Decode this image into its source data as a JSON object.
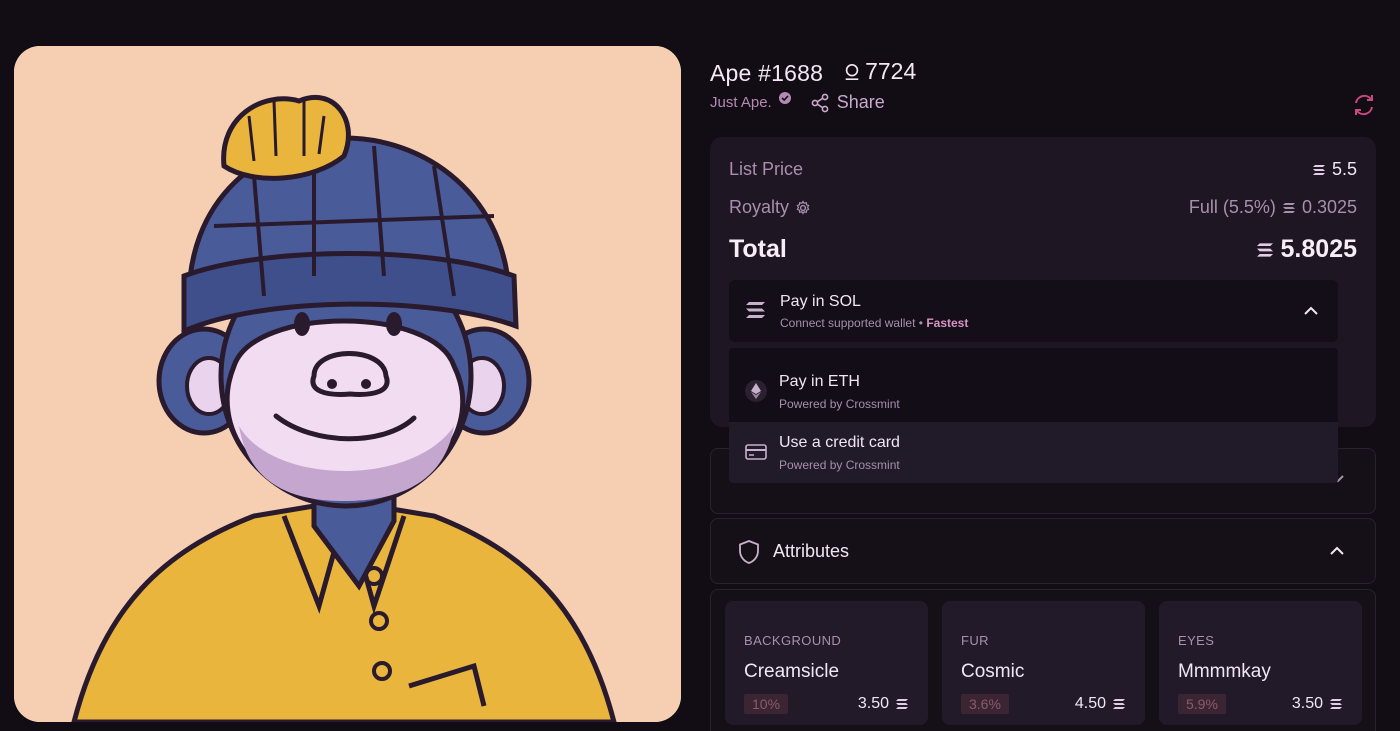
{
  "nft": {
    "name": "Ape #1688",
    "rank": "7724",
    "collection": "Just Ape.",
    "share_label": "Share"
  },
  "pricing": {
    "list_price_label": "List Price",
    "list_price_value": "5.5",
    "royalty_label": "Royalty",
    "royalty_mode": "Full (5.5%)",
    "royalty_value": "0.3025",
    "total_label": "Total",
    "total_value": "5.8025"
  },
  "payment": {
    "selected": {
      "title": "Pay in SOL",
      "subtitle": "Connect supported wallet",
      "separator": "•",
      "badge": "Fastest"
    },
    "options": [
      {
        "title": "Pay in ETH",
        "subtitle": "Powered by Crossmint",
        "icon": "ethereum-icon"
      },
      {
        "title": "Use a credit card",
        "subtitle": "Powered by Crossmint",
        "icon": "credit-card-icon"
      }
    ]
  },
  "attributes": {
    "title": "Attributes",
    "items": [
      {
        "type": "BACKGROUND",
        "value": "Creamsicle",
        "rarity": "10%",
        "price": "3.50"
      },
      {
        "type": "FUR",
        "value": "Cosmic",
        "rarity": "3.6%",
        "price": "4.50"
      },
      {
        "type": "EYES",
        "value": "Mmmmkay",
        "rarity": "5.9%",
        "price": "3.50"
      }
    ]
  },
  "colors": {
    "background": "#120c15",
    "card": "#1f1624",
    "accent": "#d994c7",
    "art_background": "#f6cfb3"
  }
}
